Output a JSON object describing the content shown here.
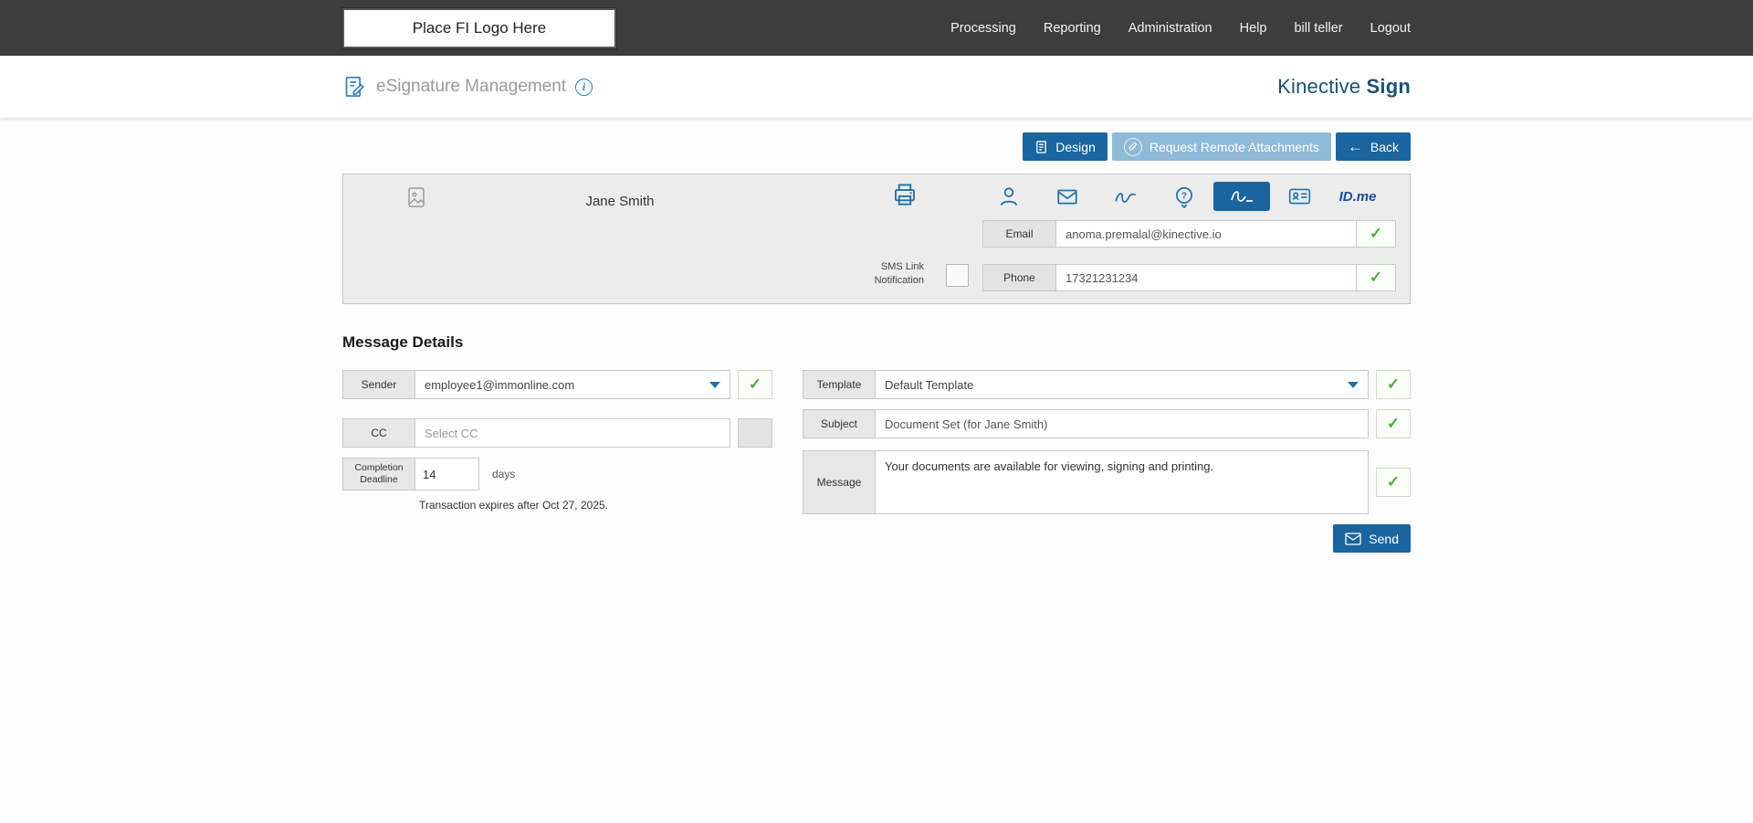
{
  "topbar": {
    "logo_text": "Place FI Logo Here",
    "nav": [
      {
        "label": "Processing"
      },
      {
        "label": "Reporting"
      },
      {
        "label": "Administration"
      },
      {
        "label": "Help"
      },
      {
        "label": "bill teller"
      },
      {
        "label": "Logout"
      }
    ]
  },
  "header": {
    "title": "eSignature Management",
    "brand_primary": "Kinective",
    "brand_bold": "Sign"
  },
  "actions": {
    "design_label": "Design",
    "attachments_label": "Request Remote Attachments",
    "back_label": "Back"
  },
  "recipient": {
    "name": "Jane Smith",
    "email_label": "Email",
    "email_value": "anoma.premalal@kinective.io",
    "sms_label": "SMS Link Notification",
    "phone_label": "Phone",
    "phone_value": "17321231234",
    "idme_label": "ID.me"
  },
  "message_details": {
    "heading": "Message Details",
    "sender_label": "Sender",
    "sender_value": "employee1@immonline.com",
    "cc_label": "CC",
    "cc_placeholder": "Select CC",
    "deadline_label": "Completion Deadline",
    "deadline_value": "14",
    "deadline_unit": "days",
    "expiry_note": "Transaction expires after Oct 27, 2025.",
    "template_label": "Template",
    "template_value": "Default Template",
    "subject_label": "Subject",
    "subject_value": "Document Set (for Jane Smith)",
    "message_label": "Message",
    "message_value": "Your documents are available for viewing, signing and printing.",
    "send_label": "Send"
  },
  "icons": {
    "check": "✓",
    "back_arrow": "←",
    "info": "i",
    "question": "?"
  },
  "colors": {
    "accent_blue": "#1a659f",
    "disabled_blue": "#8fbad8",
    "brand_navy": "#1d5173",
    "check_green": "#55a546",
    "topbar_bg": "#3d3d3d"
  }
}
